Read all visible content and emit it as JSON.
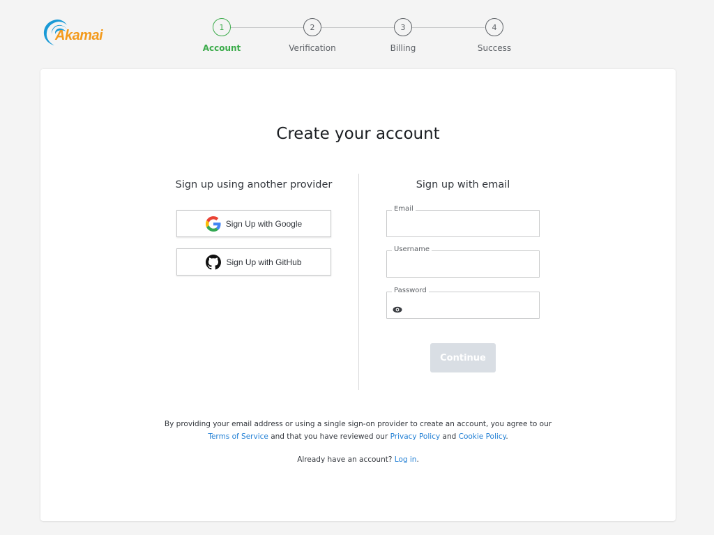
{
  "brand": {
    "name": "Akamai",
    "color": "#f39a1c",
    "swoosh_color": "#1a9ad6"
  },
  "stepper": {
    "active_color": "#3bab4a",
    "steps": [
      {
        "number": "1",
        "label": "Account",
        "active": true
      },
      {
        "number": "2",
        "label": "Verification",
        "active": false
      },
      {
        "number": "3",
        "label": "Billing",
        "active": false
      },
      {
        "number": "4",
        "label": "Success",
        "active": false
      }
    ]
  },
  "main": {
    "title": "Create your account",
    "providers": {
      "heading": "Sign up using another provider",
      "google_label": "Sign Up with Google",
      "github_label": "Sign Up with GitHub"
    },
    "email_form": {
      "heading": "Sign up with email",
      "fields": {
        "email": {
          "label": "Email",
          "value": ""
        },
        "username": {
          "label": "Username",
          "value": ""
        },
        "password": {
          "label": "Password",
          "value": ""
        }
      },
      "continue_label": "Continue",
      "continue_disabled": true
    },
    "legal": {
      "text_1": "By providing your email address or using a single sign-on provider to create an account, you agree to our",
      "terms_link": "Terms of Service",
      "text_2": " and that you have reviewed our ",
      "privacy_link": "Privacy Policy",
      "text_3": " and ",
      "cookie_link": "Cookie Policy",
      "text_4": "."
    },
    "login": {
      "prompt": "Already have an account? ",
      "link": "Log in",
      "suffix": "."
    },
    "link_color": "#1f7ed4"
  }
}
